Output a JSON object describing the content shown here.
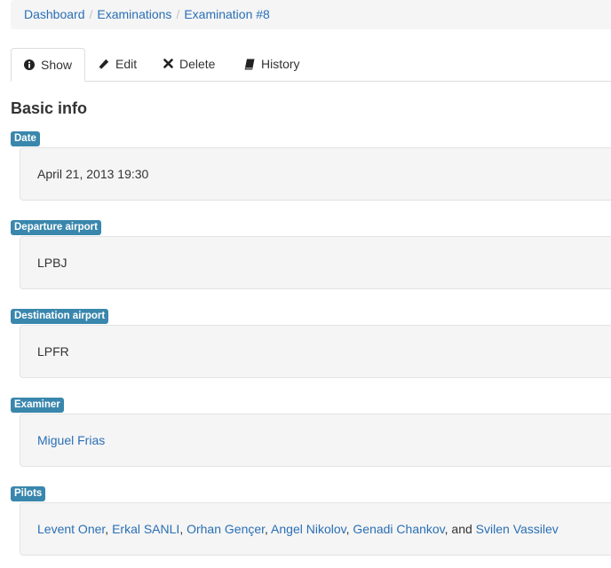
{
  "breadcrumb": {
    "items": [
      "Dashboard",
      "Examinations",
      "Examination #8"
    ],
    "separator": "/"
  },
  "tabs": [
    {
      "label": "Show",
      "icon": "info-circle-icon",
      "active": true
    },
    {
      "label": "Edit",
      "icon": "pencil-icon"
    },
    {
      "label": "Delete",
      "icon": "x-icon"
    },
    {
      "label": "History",
      "icon": "book-icon"
    }
  ],
  "section_title": "Basic info",
  "fields": {
    "date": {
      "label": "Date",
      "value": "April 21, 2013 19:30"
    },
    "departure": {
      "label": "Departure airport",
      "value": "LPBJ"
    },
    "destination": {
      "label": "Destination airport",
      "value": "LPFR"
    },
    "examiner": {
      "label": "Examiner",
      "value": "Miguel Frias"
    },
    "pilots": {
      "label": "Pilots",
      "names": [
        "Levent Oner",
        "Erkal SANLI",
        "Orhan Gençer",
        "Angel Nikolov",
        "Genadi Chankov",
        "Svilen Vassilev"
      ],
      "and_word": "and"
    }
  },
  "colors": {
    "link": "#2a6fb5",
    "label_bg": "#3a87ad",
    "well_bg": "#f5f5f5"
  }
}
